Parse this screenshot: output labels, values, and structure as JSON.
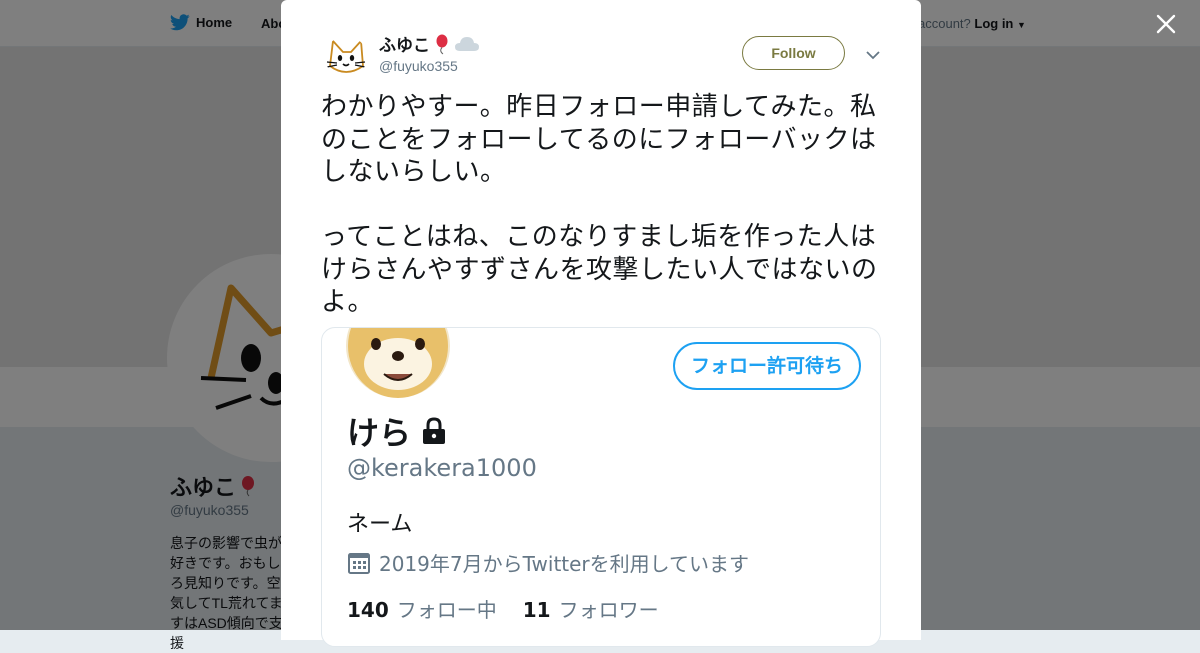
{
  "nav": {
    "home_label": "Home",
    "about_label": "Abo",
    "login_prompt": "account?",
    "login_label": "Log in"
  },
  "profile": {
    "name": "ふゆこ",
    "handle": "@fuyuko355",
    "bio": "息子の影響で虫が好きです。おもしろ見知りです。空気してTL荒れてますはASD傾向で支援"
  },
  "tweet": {
    "author_name": "ふゆこ",
    "author_handle": "@fuyuko355",
    "follow_label": "Follow",
    "text_line1": "わかりやすー。昨日フォロー申請してみた。私のことをフォローしてるのにフォローバックはしないらしい。",
    "text_line2": "ってことはね、このなりすまし垢を作った人はけらさんやすずさんを攻撃したい人ではないのよ。",
    "name_emoji": [
      "balloon-icon",
      "cloud-icon"
    ]
  },
  "media": {
    "pending_label": "フォロー許可待ち",
    "name": "けら",
    "handle": "@kerakera1000",
    "bio": "ネーム",
    "joined": "2019年7月からTwitterを利用しています",
    "following_count": "140",
    "following_label": "フォロー中",
    "followers_count": "11",
    "followers_label": "フォロワー"
  },
  "colors": {
    "twitter_blue": "#1da1f2",
    "follow_olive": "#7a7a41",
    "text_dark": "#14171a",
    "text_gray": "#657786"
  }
}
